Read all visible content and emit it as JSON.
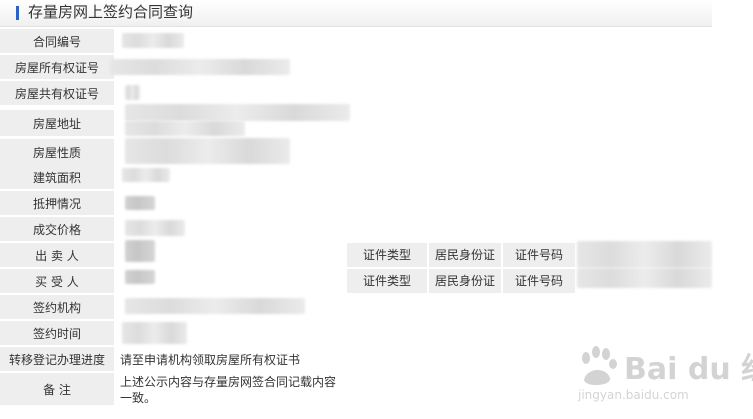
{
  "header": {
    "title": "存量房网上签约合同查询"
  },
  "fields": {
    "contract_no": "合同编号",
    "owner_cert_no": "房屋所有权证号",
    "joint_owner_cert_no": "房屋共有权证号",
    "address": "房屋地址",
    "property_type": "房屋性质",
    "floor_area": "建筑面积",
    "mortgage": "抵押情况",
    "price": "成交价格",
    "seller": "出 卖 人",
    "buyer": "买 受 人",
    "agency": "签约机构",
    "sign_time": "签约时间",
    "transfer_progress": "转移登记办理进度",
    "remarks": "备    注"
  },
  "party_info": {
    "cert_type_label": "证件类型",
    "cert_type_value": "居民身份证",
    "cert_no_label": "证件号码"
  },
  "values": {
    "transfer_progress": "请至申请机构领取房屋所有权证书",
    "remarks_line1": "上述公示内容与存量房网签合同记载内容",
    "remarks_line2": "一致。"
  },
  "watermark": {
    "brand": "Bai du 经验",
    "url": "jingyan.baidu.com"
  },
  "colors": {
    "accent": "#2a63c4",
    "label_bg": "#eeeeee"
  }
}
